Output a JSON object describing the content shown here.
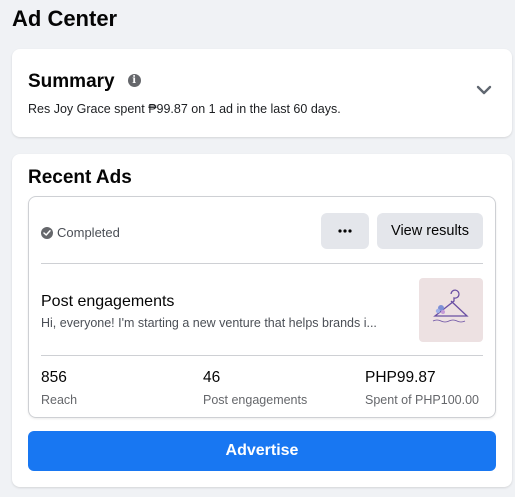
{
  "page": {
    "title": "Ad Center"
  },
  "summary": {
    "title": "Summary",
    "info_icon": "info-icon",
    "text": "Res Joy Grace spent ₱99.87 on 1 ad in the last 60 days.",
    "expand_icon": "chevron-down-icon"
  },
  "recent_ads": {
    "title": "Recent Ads",
    "ad": {
      "status": "Completed",
      "status_icon": "check-circle-icon",
      "more_label": "···",
      "view_results_label": "View results",
      "name": "Post engagements",
      "description": "Hi, everyone! I'm starting a new venture that helps brands i...",
      "thumbnail_icon": "hanger-logo",
      "metrics": [
        {
          "value": "856",
          "label": "Reach"
        },
        {
          "value": "46",
          "label": "Post engagements"
        },
        {
          "value": "PHP99.87",
          "label": "Spent of PHP100.00"
        }
      ]
    },
    "advertise_label": "Advertise"
  },
  "colors": {
    "accent": "#1877f2",
    "background": "#f0f2f5",
    "button_gray": "#e4e6eb"
  }
}
